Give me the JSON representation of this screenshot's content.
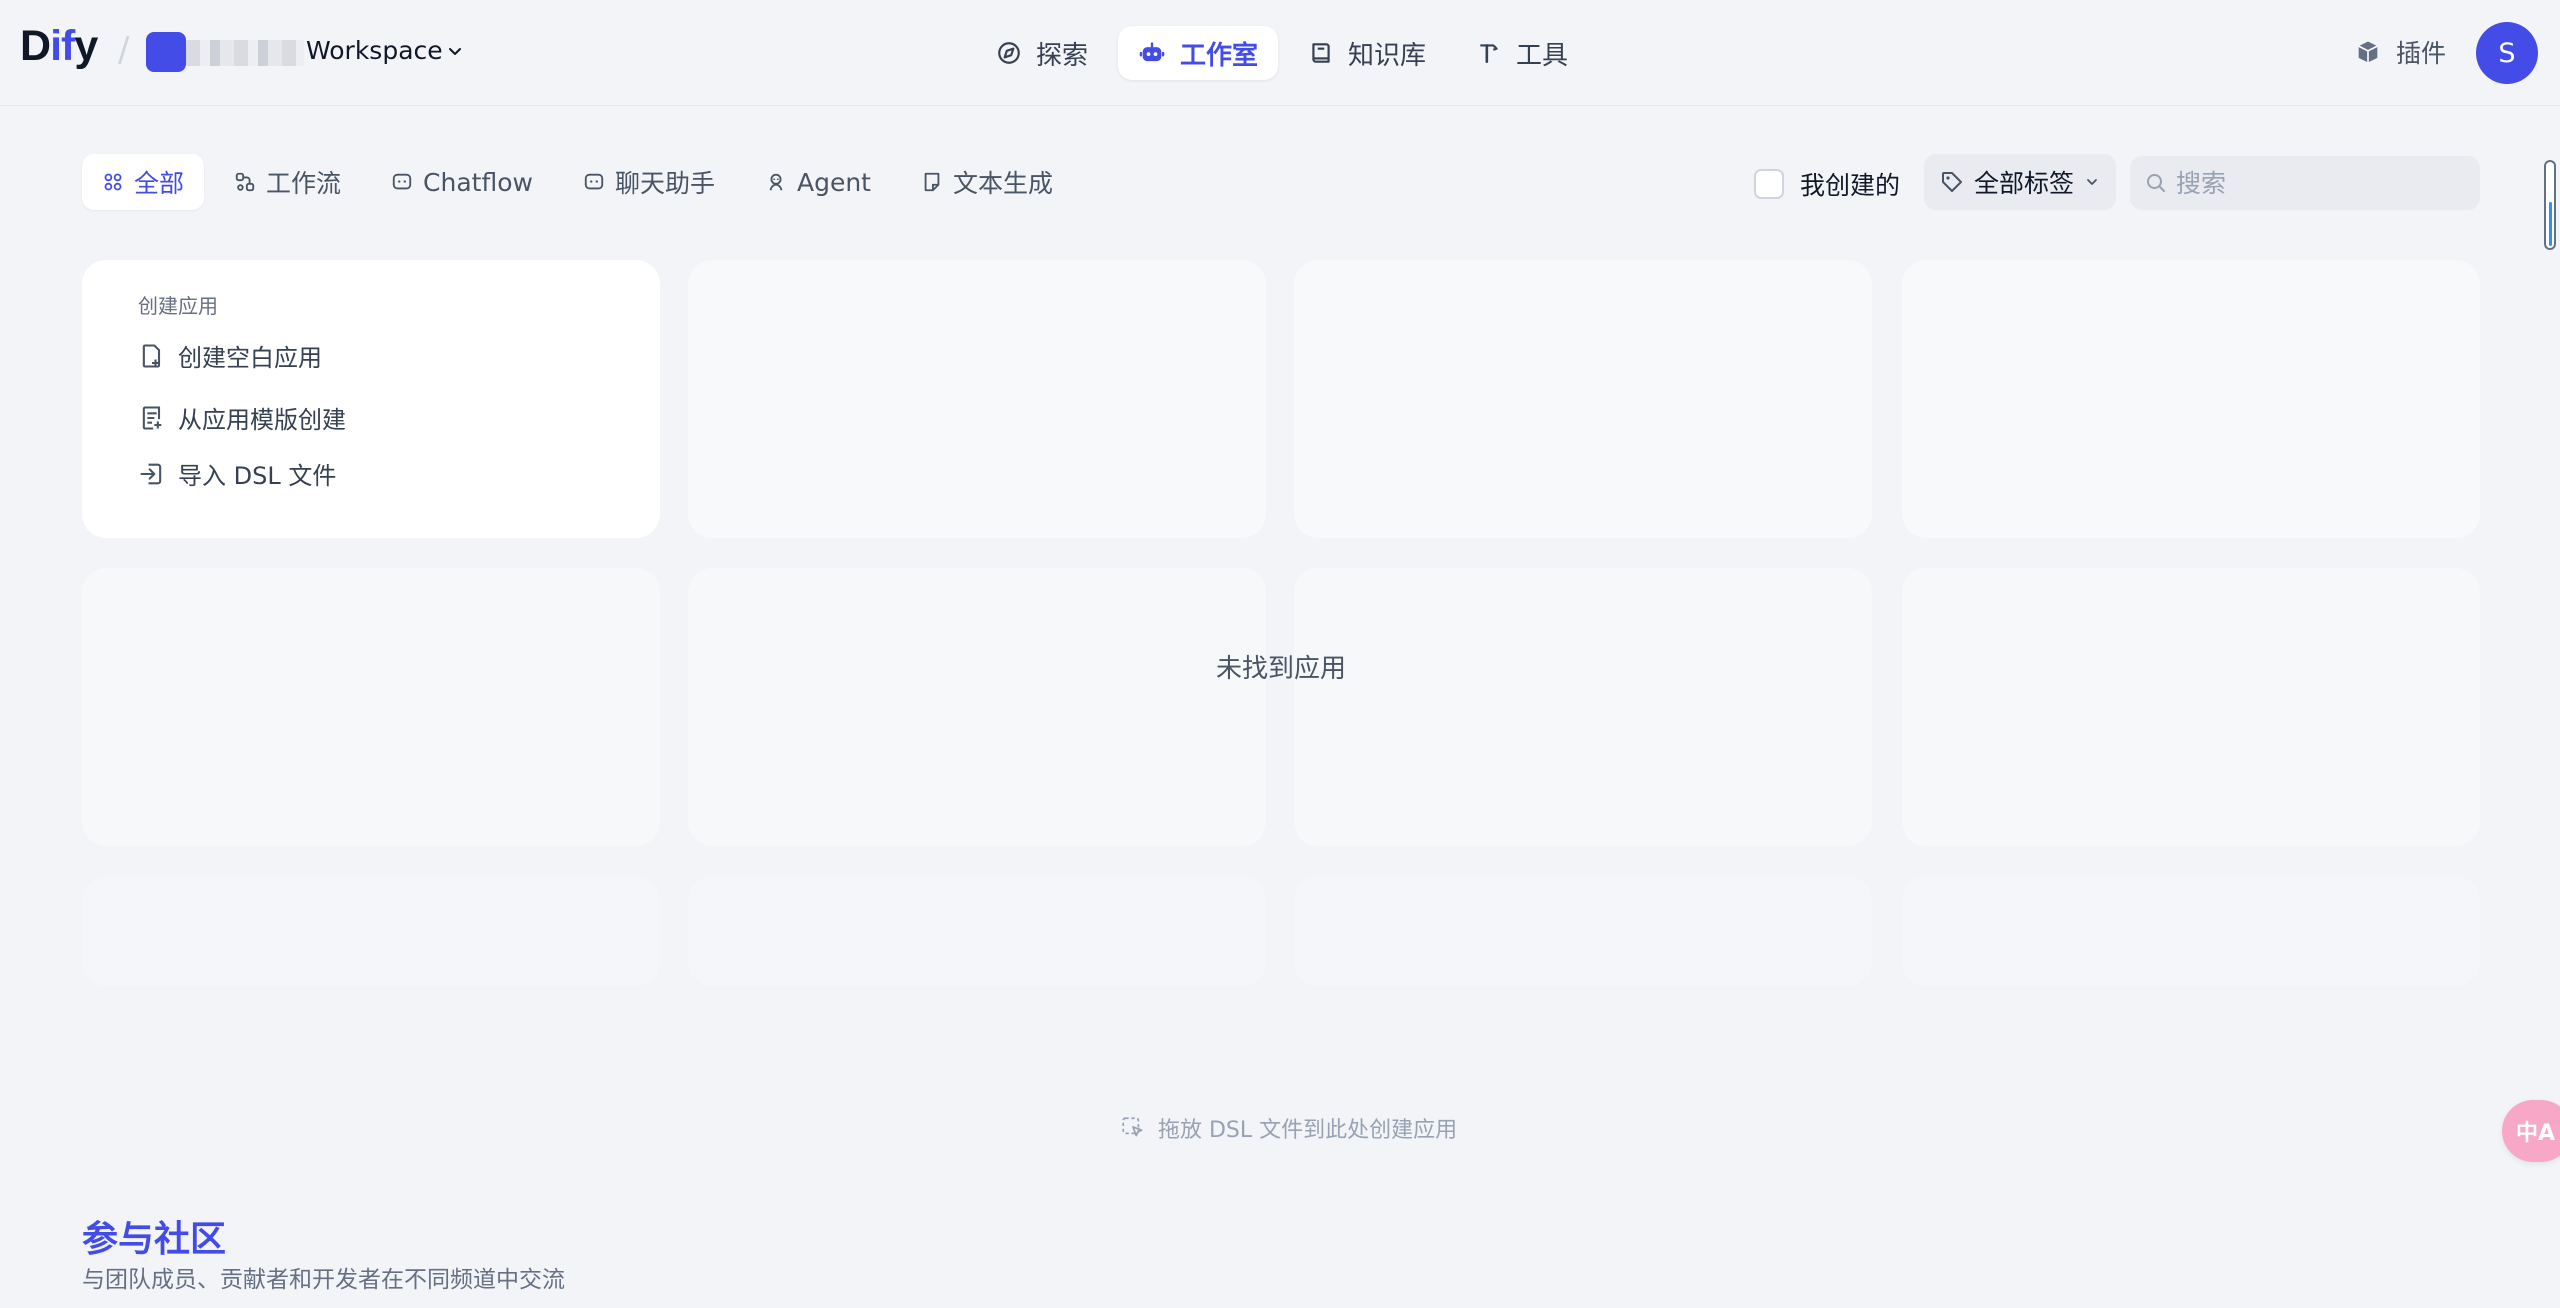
{
  "header": {
    "logo_main": "D",
    "logo_accent": "if",
    "logo_end": "y",
    "workspace_label": "Workspace",
    "nav": [
      {
        "label": "探索",
        "icon": "compass-icon"
      },
      {
        "label": "工作室",
        "icon": "robot-icon"
      },
      {
        "label": "知识库",
        "icon": "book-icon"
      },
      {
        "label": "工具",
        "icon": "hammer-icon"
      }
    ],
    "plugin_label": "插件",
    "user_initial": "S"
  },
  "filters": {
    "tabs": [
      {
        "label": "全部",
        "icon": "grid-icon"
      },
      {
        "label": "工作流",
        "icon": "workflow-icon"
      },
      {
        "label": "Chatflow",
        "icon": "chat-bubble-icon"
      },
      {
        "label": "聊天助手",
        "icon": "chat-bubble-icon"
      },
      {
        "label": "Agent",
        "icon": "agent-icon"
      },
      {
        "label": "文本生成",
        "icon": "document-icon"
      }
    ],
    "mine_label": "我创建的",
    "tag_label": "全部标签",
    "search_placeholder": "搜索"
  },
  "create": {
    "title": "创建应用",
    "items": [
      {
        "label": "创建空白应用",
        "icon": "file-plus-icon"
      },
      {
        "label": "从应用模版创建",
        "icon": "template-icon"
      },
      {
        "label": "导入 DSL 文件",
        "icon": "import-icon"
      }
    ]
  },
  "empty_text": "未找到应用",
  "drop_hint": "拖放 DSL 文件到此处创建应用",
  "community": {
    "title": "参与社区",
    "subtitle": "与团队成员、贡献者和开发者在不同频道中交流"
  },
  "translate_button": {
    "label": "中A"
  },
  "colors": {
    "accent": "#444ce7",
    "background": "#f2f4f7",
    "card": "#ffffff"
  }
}
